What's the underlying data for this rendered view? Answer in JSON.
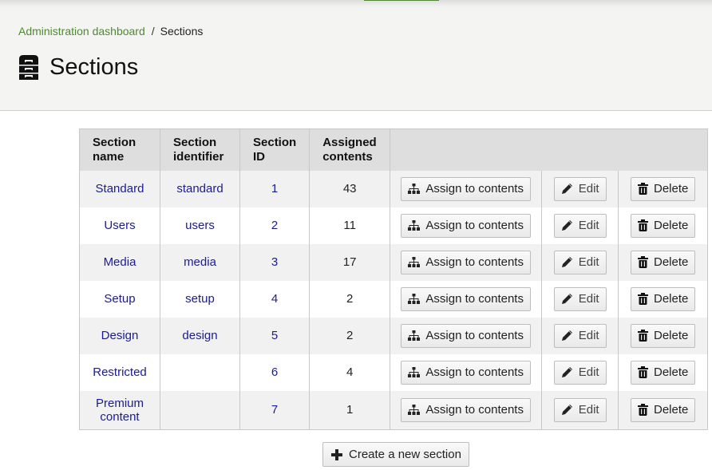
{
  "breadcrumb": {
    "parent": "Administration dashboard",
    "separator": "/",
    "current": "Sections"
  },
  "page": {
    "title": "Sections",
    "icon": "cabinet-icon"
  },
  "table": {
    "headers": {
      "name": "Section name",
      "identifier": "Section identifier",
      "id": "Section ID",
      "assigned": "Assigned contents",
      "actions": ""
    },
    "actions": {
      "assign_label": "Assign to contents",
      "assign_icon": "sitemap-icon",
      "edit_label": "Edit",
      "edit_icon": "pencil-icon",
      "delete_label": "Delete",
      "delete_icon": "trash-icon"
    },
    "rows": [
      {
        "name": "Standard",
        "identifier": "standard",
        "id": "1",
        "assigned": "43"
      },
      {
        "name": "Users",
        "identifier": "users",
        "id": "2",
        "assigned": "11"
      },
      {
        "name": "Media",
        "identifier": "media",
        "id": "3",
        "assigned": "17"
      },
      {
        "name": "Setup",
        "identifier": "setup",
        "id": "4",
        "assigned": "2"
      },
      {
        "name": "Design",
        "identifier": "design",
        "id": "5",
        "assigned": "2"
      },
      {
        "name": "Restricted",
        "identifier": "",
        "id": "6",
        "assigned": "4"
      },
      {
        "name": "Premium content",
        "identifier": "",
        "id": "7",
        "assigned": "1"
      }
    ]
  },
  "create_button": {
    "label": "Create a new section",
    "icon": "plus-icon"
  },
  "colors": {
    "accent_green": "#4f8a2c",
    "link_blue": "#1a1a9a",
    "header_bg": "#f4f4f3",
    "table_head_bg": "#dedede",
    "row_alt_bg": "#f1f1f1"
  }
}
